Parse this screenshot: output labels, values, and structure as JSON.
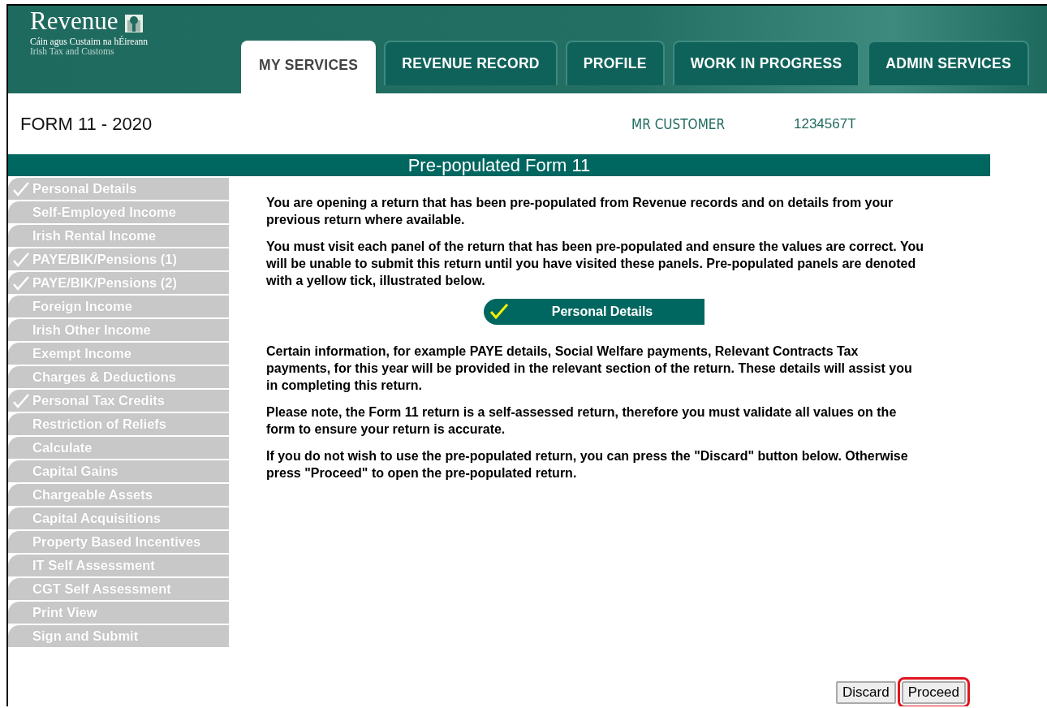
{
  "logo": {
    "name": "Revenue",
    "subtitle_irish": "Cáin agus Custaim na hÉireann",
    "subtitle_english": "Irish Tax and Customs"
  },
  "tabs": [
    {
      "label": "MY SERVICES",
      "selected": true
    },
    {
      "label": "REVENUE RECORD",
      "selected": false
    },
    {
      "label": "PROFILE",
      "selected": false
    },
    {
      "label": "WORK IN PROGRESS",
      "selected": false
    },
    {
      "label": "ADMIN SERVICES",
      "selected": false
    }
  ],
  "form_title": "FORM 11 - 2020",
  "customer": {
    "name": "MR CUSTOMER",
    "id": "1234567T"
  },
  "page_title": "Pre-populated Form 11",
  "sidebar": {
    "items": [
      {
        "label": "Personal Details",
        "checked": true
      },
      {
        "label": "Self-Employed Income",
        "checked": false
      },
      {
        "label": "Irish Rental Income",
        "checked": false
      },
      {
        "label": "PAYE/BIK/Pensions (1)",
        "checked": true
      },
      {
        "label": "PAYE/BIK/Pensions (2)",
        "checked": true
      },
      {
        "label": "Foreign Income",
        "checked": false
      },
      {
        "label": "Irish Other Income",
        "checked": false
      },
      {
        "label": "Exempt Income",
        "checked": false
      },
      {
        "label": "Charges & Deductions",
        "checked": false
      },
      {
        "label": "Personal Tax Credits",
        "checked": true
      },
      {
        "label": "Restriction of Reliefs",
        "checked": false
      },
      {
        "label": "Calculate",
        "checked": false
      },
      {
        "label": "Capital Gains",
        "checked": false
      },
      {
        "label": "Chargeable Assets",
        "checked": false
      },
      {
        "label": "Capital Acquisitions",
        "checked": false
      },
      {
        "label": "Property Based Incentives",
        "checked": false
      },
      {
        "label": "IT Self Assessment",
        "checked": false
      },
      {
        "label": "CGT Self Assessment",
        "checked": false
      },
      {
        "label": "Print View",
        "checked": false
      },
      {
        "label": "Sign and Submit",
        "checked": false
      }
    ]
  },
  "content": [
    {
      "kind": "paragraph",
      "text": "You are opening a return that has been pre-populated from Revenue records and on details from your previous return where available."
    },
    {
      "kind": "paragraph",
      "text": "You must visit each panel of the return that has been pre-populated and ensure the values are correct. You will be unable to submit this return until you have visited these panels. Pre-populated panels are denoted with a yellow tick, illustrated below."
    },
    {
      "kind": "sample_panel",
      "text": "Personal Details",
      "checked": true
    },
    {
      "kind": "paragraph",
      "text": "Certain information, for example PAYE details, Social Welfare payments, Relevant Contracts Tax payments, for this year will be provided in the relevant section of the return. These details will assist you in completing this return."
    },
    {
      "kind": "paragraph",
      "text": "Please note, the Form 11 return is a self-assessed return, therefore you must validate all values on the form to ensure your return is accurate."
    },
    {
      "kind": "paragraph",
      "text": "If you do not wish to use the pre-populated return, you can press the \"Discard\" button below. Otherwise press \"Proceed\" to open the pre-populated return."
    }
  ],
  "buttons": [
    {
      "label": "Discard",
      "highlighted": false
    },
    {
      "label": "Proceed",
      "highlighted": true
    }
  ]
}
